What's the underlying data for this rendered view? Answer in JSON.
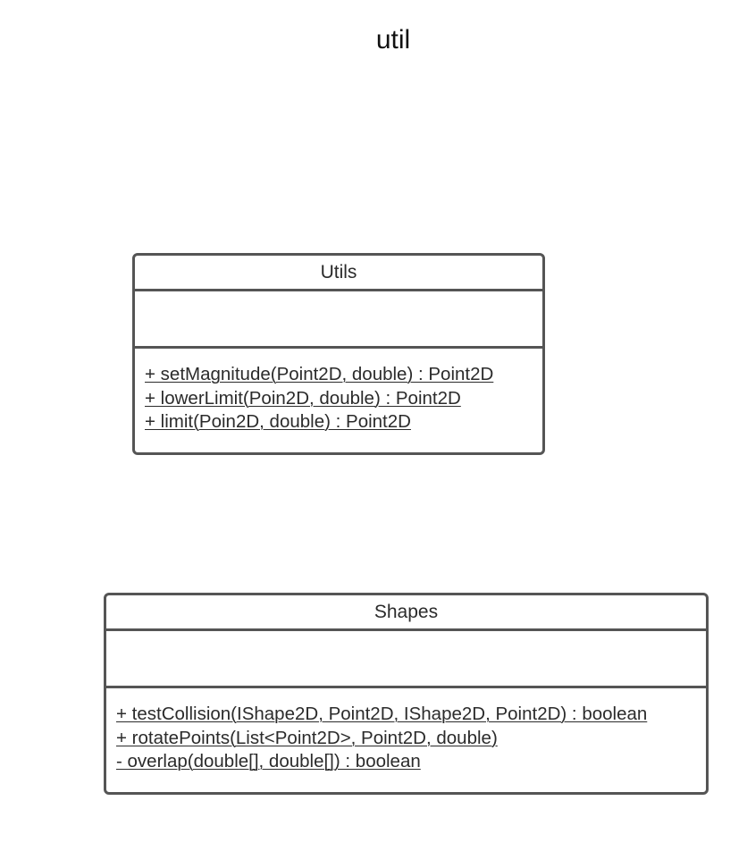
{
  "package": {
    "title": "util"
  },
  "classes": [
    {
      "name": "Utils",
      "operations": [
        "+ setMagnitude(Point2D, double) : Point2D",
        "+ lowerLimit(Poin2D, double) : Point2D",
        "+ limit(Poin2D, double) : Point2D"
      ]
    },
    {
      "name": "Shapes",
      "operations": [
        "+ testCollision(IShape2D, Point2D, IShape2D, Point2D) : boolean",
        "+ rotatePoints(List<Point2D>, Point2D, double)",
        "- overlap(double[], double[]) : boolean"
      ]
    }
  ]
}
